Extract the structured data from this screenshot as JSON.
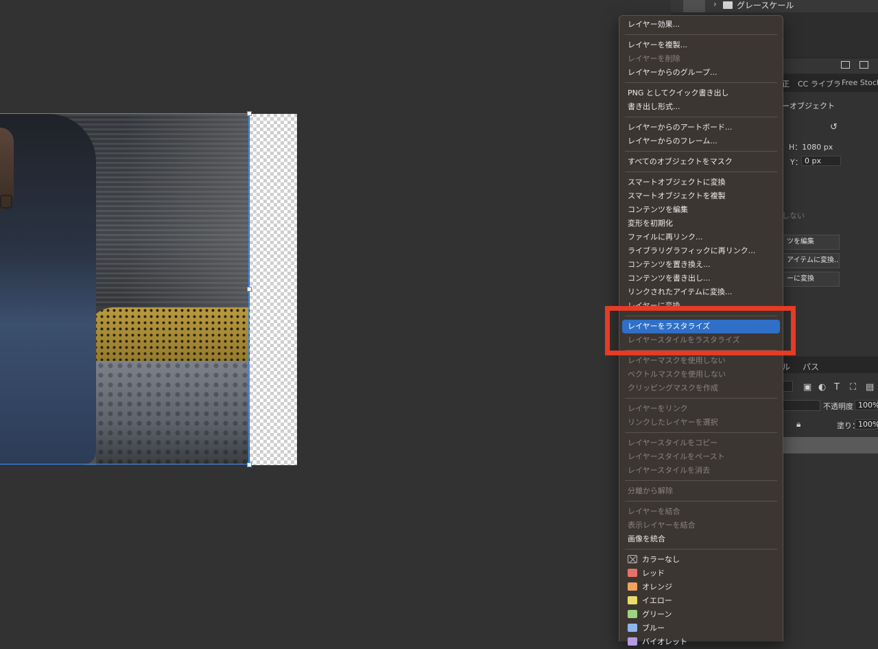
{
  "layers_panel": {
    "top_layer_name": "グレースケール"
  },
  "properties_panel": {
    "tabs": [
      "正",
      "CC ライブラ",
      "Free Stock"
    ],
    "object_type": "ーオブジェクト",
    "h_label": "H：1080 px",
    "y_label": "Y：",
    "y_value": "0 px",
    "disabled_hint": "しない",
    "buttons": [
      "ツを編集",
      "アイテムに変換...",
      "ーに変換"
    ]
  },
  "lower_panel": {
    "tabs": [
      "ル",
      "パス"
    ],
    "opacity_label": "不透明度：",
    "opacity_value": "100%",
    "fill_label": "塗り：",
    "fill_value": "100%"
  },
  "context_menu": {
    "items": [
      {
        "label": "レイヤー効果...",
        "state": "enabled"
      },
      {
        "sep": true
      },
      {
        "label": "レイヤーを複製...",
        "state": "enabled"
      },
      {
        "label": "レイヤーを削除",
        "state": "disabled"
      },
      {
        "label": "レイヤーからのグループ...",
        "state": "enabled"
      },
      {
        "sep": true
      },
      {
        "label": "PNG としてクイック書き出し",
        "state": "enabled"
      },
      {
        "label": "書き出し形式...",
        "state": "enabled"
      },
      {
        "sep": true
      },
      {
        "label": "レイヤーからのアートボード...",
        "state": "enabled"
      },
      {
        "label": "レイヤーからのフレーム...",
        "state": "enabled"
      },
      {
        "sep": true
      },
      {
        "label": "すべてのオブジェクトをマスク",
        "state": "enabled"
      },
      {
        "sep": true
      },
      {
        "label": "スマートオブジェクトに変換",
        "state": "enabled"
      },
      {
        "label": "スマートオブジェクトを複製",
        "state": "enabled"
      },
      {
        "label": "コンテンツを編集",
        "state": "enabled"
      },
      {
        "label": "変形を初期化",
        "state": "enabled"
      },
      {
        "label": "ファイルに再リンク...",
        "state": "enabled"
      },
      {
        "label": "ライブラリグラフィックに再リンク...",
        "state": "enabled"
      },
      {
        "label": "コンテンツを置き換え...",
        "state": "enabled"
      },
      {
        "label": "コンテンツを書き出し...",
        "state": "enabled"
      },
      {
        "label": "リンクされたアイテムに変換...",
        "state": "enabled"
      },
      {
        "label": "レイヤーに変換",
        "state": "obscured"
      },
      {
        "sep": true
      },
      {
        "label": "レイヤーをラスタライズ",
        "state": "highlighted"
      },
      {
        "label": "レイヤースタイルをラスタライズ",
        "state": "disabled"
      },
      {
        "sep": true
      },
      {
        "label": "レイヤーマスクを使用しない",
        "state": "disabled"
      },
      {
        "label": "ベクトルマスクを使用しない",
        "state": "disabled"
      },
      {
        "label": "クリッピングマスクを作成",
        "state": "disabled"
      },
      {
        "sep": true
      },
      {
        "label": "レイヤーをリンク",
        "state": "disabled"
      },
      {
        "label": "リンクしたレイヤーを選択",
        "state": "disabled"
      },
      {
        "sep": true
      },
      {
        "label": "レイヤースタイルをコピー",
        "state": "disabled"
      },
      {
        "label": "レイヤースタイルをペースト",
        "state": "disabled"
      },
      {
        "label": "レイヤースタイルを消去",
        "state": "disabled"
      },
      {
        "sep": true
      },
      {
        "label": "分離から解除",
        "state": "disabled"
      },
      {
        "sep": true
      },
      {
        "label": "レイヤーを結合",
        "state": "disabled"
      },
      {
        "label": "表示レイヤーを結合",
        "state": "disabled"
      },
      {
        "label": "画像を統合",
        "state": "enabled"
      },
      {
        "sep": true
      },
      {
        "label": "カラーなし",
        "state": "enabled",
        "swatch": "none"
      },
      {
        "label": "レッド",
        "state": "enabled",
        "swatch": "#e8706b"
      },
      {
        "label": "オレンジ",
        "state": "enabled",
        "swatch": "#f0a25f"
      },
      {
        "label": "イエロー",
        "state": "enabled",
        "swatch": "#e8dc6c"
      },
      {
        "label": "グリーン",
        "state": "enabled",
        "swatch": "#9bd67f"
      },
      {
        "label": "ブルー",
        "state": "enabled",
        "swatch": "#8fb5ee"
      },
      {
        "label": "バイオレット",
        "state": "enabled",
        "swatch": "#b79be0"
      }
    ]
  },
  "colors": {
    "menu_bg": "#3c3633",
    "highlight": "#2f6fc7",
    "annotation": "#e63b25",
    "selection": "#3d8ef0"
  }
}
